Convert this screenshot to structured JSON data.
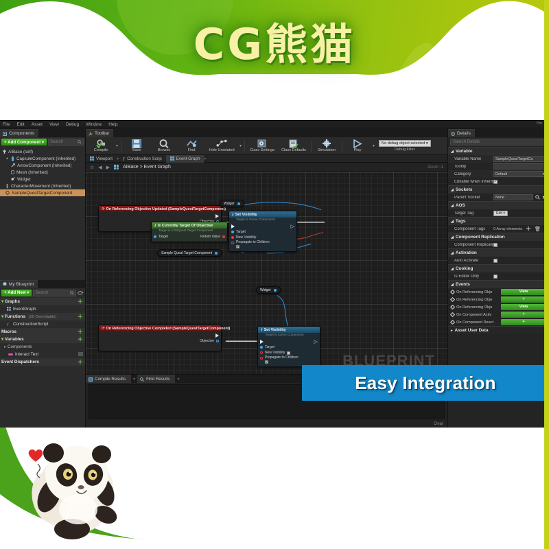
{
  "promo": {
    "title": "CG熊猫",
    "banner_text": "Easy Integration",
    "banner_color": "#1288ca",
    "header_green": "#61b312",
    "accent_strip": "#c4d11a"
  },
  "menubar": [
    "File",
    "Edit",
    "Asset",
    "View",
    "Debug",
    "Window",
    "Help"
  ],
  "components_panel": {
    "tab_label": "Components",
    "add_button": "+ Add Component ▾",
    "search_placeholder": "Search",
    "tree": [
      {
        "label": "AIBase (self)",
        "indent": 0,
        "icon": "actor-icon",
        "selected": false
      },
      {
        "label": "CapsuleComponent (Inherited)",
        "indent": 1,
        "icon": "capsule-icon",
        "selected": false
      },
      {
        "label": "ArrowComponent (Inherited)",
        "indent": 2,
        "icon": "arrow-icon",
        "selected": false
      },
      {
        "label": "Mesh (Inherited)",
        "indent": 2,
        "icon": "mesh-icon",
        "selected": false
      },
      {
        "label": "Widget",
        "indent": 2,
        "icon": "widget-icon",
        "selected": false
      },
      {
        "label": "CharacterMovement (Inherited)",
        "indent": 1,
        "icon": "movement-icon",
        "selected": false
      },
      {
        "label": "SampleQuestTargetComponent",
        "indent": 1,
        "icon": "component-icon",
        "selected": true
      }
    ]
  },
  "myblueprint_panel": {
    "tab_label": "My Blueprint",
    "add_button": "+ Add New ▾",
    "search_placeholder": "Search",
    "rows": [
      {
        "label": "Graphs",
        "sub": "",
        "category": true,
        "plus": true
      },
      {
        "label": "EventGraph",
        "sub": "",
        "category": false,
        "plus": false
      },
      {
        "label": "Functions",
        "sub": "(20 Overridable)",
        "category": true,
        "plus": true
      },
      {
        "label": "ConstructionScript",
        "sub": "",
        "category": false,
        "plus": false
      },
      {
        "label": "Macros",
        "sub": "",
        "category": true,
        "plus": true
      },
      {
        "label": "Variables",
        "sub": "",
        "category": true,
        "plus": true
      },
      {
        "label": "Components",
        "sub": "",
        "category": false,
        "plus": false
      },
      {
        "label": "Interact Text",
        "sub": "",
        "category": false,
        "plus": false
      },
      {
        "label": "Event Dispatchers",
        "sub": "",
        "category": true,
        "plus": true
      }
    ]
  },
  "toolbar": {
    "tab_label": "Toolbar",
    "buttons": [
      {
        "label": "Compile",
        "icon": "compile-icon"
      },
      {
        "label": "Save",
        "icon": "save-icon"
      },
      {
        "label": "Browse",
        "icon": "browse-icon"
      },
      {
        "label": "Find",
        "icon": "find-icon"
      },
      {
        "label": "Hide Unrelated",
        "icon": "hide-unrelated-icon"
      },
      {
        "label": "Class Settings",
        "icon": "class-settings-icon"
      },
      {
        "label": "Class Defaults",
        "icon": "class-defaults-icon"
      },
      {
        "label": "Simulation",
        "icon": "simulation-icon"
      },
      {
        "label": "Play",
        "icon": "play-icon"
      }
    ],
    "debug_object": "No debug object selected",
    "debug_filter_label": "Debug Filter"
  },
  "mode_tabs": [
    {
      "label": "Viewport",
      "active": false,
      "icon": "viewport-icon"
    },
    {
      "label": "Construction Scrip",
      "active": false,
      "icon": "function-icon"
    },
    {
      "label": "Event Graph",
      "active": true,
      "icon": "graph-icon"
    }
  ],
  "breadcrumb": {
    "path": "AIBase > Event Graph",
    "zoom": "Zoom -1"
  },
  "graph": {
    "watermark": "BLUEPRINT",
    "nodes": [
      {
        "id": "event_updated",
        "kind": "event",
        "title": "On Referencing Objective Updated (SampleQuestTargetComponent)",
        "out_pins": [
          "Objective"
        ]
      },
      {
        "id": "is_currently_target",
        "kind": "pure",
        "title": "Is Currently Target Of Objective",
        "subtitle": "Target is AOSQuest Target Component",
        "in_pins": [
          "Target"
        ],
        "out_pins": [
          "Return Value"
        ]
      },
      {
        "id": "var_sqtc",
        "kind": "variable",
        "title": "Sample Quest Target Component"
      },
      {
        "id": "var_widget_1",
        "kind": "variable",
        "title": "Widget"
      },
      {
        "id": "set_visibility_1",
        "kind": "fn",
        "title": "Set Visibility",
        "subtitle": "Target is Scene Component",
        "in_pins": [
          "Target",
          "New Visibility",
          "Propagate to Children"
        ]
      },
      {
        "id": "event_completed",
        "kind": "event",
        "title": "On Referencing Objective Completed (SampleQuestTargetComponent)",
        "out_pins": [
          "Objective"
        ]
      },
      {
        "id": "var_widget_2",
        "kind": "variable",
        "title": "Widget"
      },
      {
        "id": "set_visibility_2",
        "kind": "fn",
        "title": "Set Visibility",
        "subtitle": "Target is Scene Component",
        "in_pins": [
          "Target",
          "New Visibility",
          "Propagate to Children"
        ]
      }
    ]
  },
  "results_panel": {
    "tabs": [
      {
        "label": "Compile Results",
        "icon": "compile-results-icon"
      },
      {
        "label": "Find Results",
        "icon": "find-results-icon"
      }
    ],
    "clear_label": "Clear"
  },
  "details_panel": {
    "tab_label": "Details",
    "pin_label": "Pin",
    "search_placeholder": "Search Details",
    "sections": [
      {
        "title": "Variable",
        "rows": [
          {
            "label": "Variable Name",
            "type": "text",
            "value": "SampleQuestTargetCo"
          },
          {
            "label": "Tooltip",
            "type": "text",
            "value": ""
          },
          {
            "label": "Category",
            "type": "combo",
            "value": "Default"
          },
          {
            "label": "Editable when Inherited",
            "type": "check",
            "checked": true
          }
        ]
      },
      {
        "title": "Sockets",
        "rows": [
          {
            "label": "Parent Socket",
            "type": "socket",
            "value": "None"
          }
        ]
      },
      {
        "title": "AOS",
        "rows": [
          {
            "label": "Target Tag",
            "type": "edit",
            "value": "Edit ▾"
          }
        ]
      },
      {
        "title": "Tags",
        "rows": [
          {
            "label": "Component Tags",
            "type": "array",
            "value": "0 Array elements"
          }
        ]
      },
      {
        "title": "Component Replication",
        "rows": [
          {
            "label": "Component Replicates",
            "type": "check",
            "checked": false
          }
        ]
      },
      {
        "title": "Activation",
        "rows": [
          {
            "label": "Auto Activate",
            "type": "check",
            "checked": false
          }
        ]
      },
      {
        "title": "Cooking",
        "rows": [
          {
            "label": "Is Editor Only",
            "type": "check",
            "checked": false
          }
        ]
      }
    ],
    "events_section_title": "Events",
    "events": [
      {
        "label": "On Referencing Obje",
        "button": "View"
      },
      {
        "label": "On Referencing Obje",
        "button": "+"
      },
      {
        "label": "On Referencing Obje",
        "button": "View"
      },
      {
        "label": "On Component Activ",
        "button": "+"
      },
      {
        "label": "On Component Deact",
        "button": "+"
      }
    ],
    "asset_user_data": "Asset User Data"
  }
}
